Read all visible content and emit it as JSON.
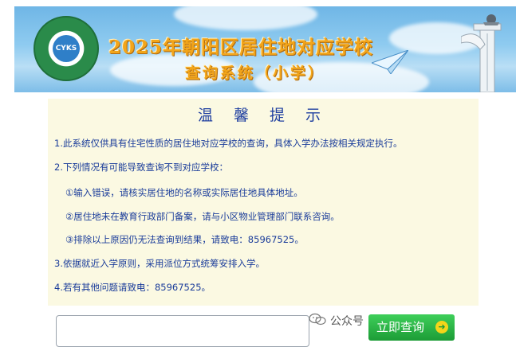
{
  "banner": {
    "title": "2025年朝阳区居住地对应学校",
    "subtitle": "查询系统（小学）",
    "logo_text": "CYKS"
  },
  "notice": {
    "title": "温 馨 提 示",
    "lines": [
      "1.此系统仅供具有住宅性质的居住地对应学校的查询，具体入学办法按相关规定执行。",
      "2.下列情况有可能导致查询不到对应学校：",
      "①输入错误，请核实居住地的名称或实际居住地具体地址。",
      "②居住地未在教育行政部门备案，请与小区物业管理部门联系咨询。",
      "③排除以上原因仍无法查询到结果，请致电：85967525。",
      "3.依据就近入学原则，采用派位方式统筹安排入学。",
      "4.若有其他问题请致电：85967525。"
    ]
  },
  "search": {
    "placeholder": "",
    "button_label": "立即查询"
  },
  "watermark": {
    "text": "公众号 · 舒媛妈妈育儿说"
  },
  "colors": {
    "notice_text": "#1a3c9a",
    "notice_bg": "#fbf9e2",
    "button_green": "#1d9c36",
    "title_orange": "#f2a51a"
  }
}
